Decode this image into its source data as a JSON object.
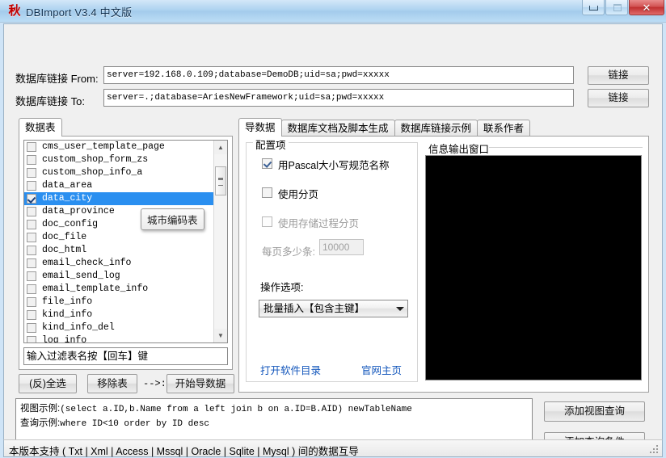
{
  "window": {
    "icon_glyph": "秋",
    "title": "DBImport V3.4 中文版",
    "buttons": {
      "minimize": "minimize",
      "maximize": "maximize",
      "close": "✕"
    }
  },
  "connection": {
    "from_label": "数据库链接 From:",
    "from_value": "server=192.168.0.109;database=DemoDB;uid=sa;pwd=xxxxx",
    "to_label": "数据库链接 To:",
    "to_value": "server=.;database=AriesNewFramework;uid=sa;pwd=xxxxx",
    "from_button": "链接",
    "to_button": "链接"
  },
  "left_panel": {
    "tab_label": "数据表",
    "tables": [
      {
        "name": "cms_user_template_page",
        "checked": false,
        "selected": false
      },
      {
        "name": "custom_shop_form_zs",
        "checked": false,
        "selected": false
      },
      {
        "name": "custom_shop_info_a",
        "checked": false,
        "selected": false
      },
      {
        "name": "data_area",
        "checked": false,
        "selected": false
      },
      {
        "name": "data_city",
        "checked": true,
        "selected": true
      },
      {
        "name": "data_province",
        "checked": false,
        "selected": false
      },
      {
        "name": "doc_config",
        "checked": false,
        "selected": false
      },
      {
        "name": "doc_file",
        "checked": false,
        "selected": false
      },
      {
        "name": "doc_html",
        "checked": false,
        "selected": false
      },
      {
        "name": "email_check_info",
        "checked": false,
        "selected": false
      },
      {
        "name": "email_send_log",
        "checked": false,
        "selected": false
      },
      {
        "name": "email_template_info",
        "checked": false,
        "selected": false
      },
      {
        "name": "file_info",
        "checked": false,
        "selected": false
      },
      {
        "name": "kind_info",
        "checked": false,
        "selected": false
      },
      {
        "name": "kind_info_del",
        "checked": false,
        "selected": false
      },
      {
        "name": "log_info",
        "checked": false,
        "selected": false
      }
    ],
    "tooltip": "城市编码表",
    "filter_text": "输入过滤表名按【回车】键",
    "select_all_button": "(反)全选",
    "remove_button": "移除表",
    "arrow_text": "-->:",
    "start_button": "开始导数据"
  },
  "right_panel": {
    "tabs": [
      {
        "label": "导数据",
        "active": true
      },
      {
        "label": "数据库文档及脚本生成",
        "active": false
      },
      {
        "label": "数据库链接示例",
        "active": false
      },
      {
        "label": "联系作者",
        "active": false
      }
    ],
    "config_group_title": "配置项",
    "options": [
      {
        "label": "用Pascal大小写规范名称",
        "checked": true,
        "disabled": false
      },
      {
        "label": "使用分页",
        "checked": false,
        "disabled": false
      },
      {
        "label": "使用存储过程分页",
        "checked": false,
        "disabled": true
      }
    ],
    "page_size_label": "每页多少条:",
    "page_size_value": "10000",
    "operation_label": "操作选项:",
    "operation_value": "批量插入【包含主键】",
    "link_open_dir": "打开软件目录",
    "link_homepage": "官网主页",
    "output_group_title": "信息输出窗口",
    "output_text": ""
  },
  "bottom": {
    "view_example_label": "视图示例:",
    "view_example_value": "(select a.ID,b.Name from a left join b on a.ID=B.AID) newTableName",
    "query_example_label": "查询示例:",
    "query_example_value": "where ID<10 order by ID desc",
    "add_view_button": "添加视图查询",
    "add_query_button": "添加查询条件"
  },
  "statusbar": {
    "text": "本版本支持 ( Txt | Xml | Access | Mssql | Oracle | Sqlite | Mysql ) 间的数据互导"
  }
}
